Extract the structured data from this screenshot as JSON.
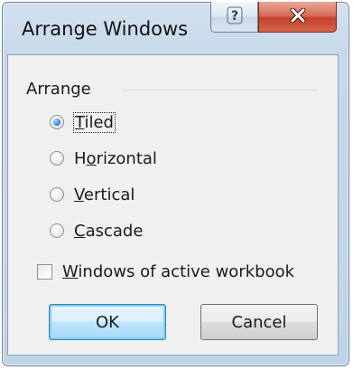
{
  "dialog": {
    "title": "Arrange Windows",
    "help_icon": "question-mark-icon",
    "close_icon": "close-icon"
  },
  "arrange": {
    "group_label": "Arrange",
    "selected": "Tiled",
    "options": [
      {
        "label": "Tiled",
        "mnemonic_index": 0,
        "checked": true
      },
      {
        "label": "Horizontal",
        "mnemonic_index": 1,
        "checked": false
      },
      {
        "label": "Vertical",
        "mnemonic_index": 0,
        "checked": false
      },
      {
        "label": "Cascade",
        "mnemonic_index": 0,
        "checked": false
      }
    ]
  },
  "workbook_option": {
    "label": "Windows of active workbook",
    "checked": false
  },
  "buttons": {
    "ok_label": "OK",
    "cancel_label": "Cancel"
  },
  "colors": {
    "frame": "#c6d8ea",
    "close_button": "#c4412a",
    "default_button_border": "#3c7fb1",
    "radio_dot": "#3d8ee0"
  }
}
